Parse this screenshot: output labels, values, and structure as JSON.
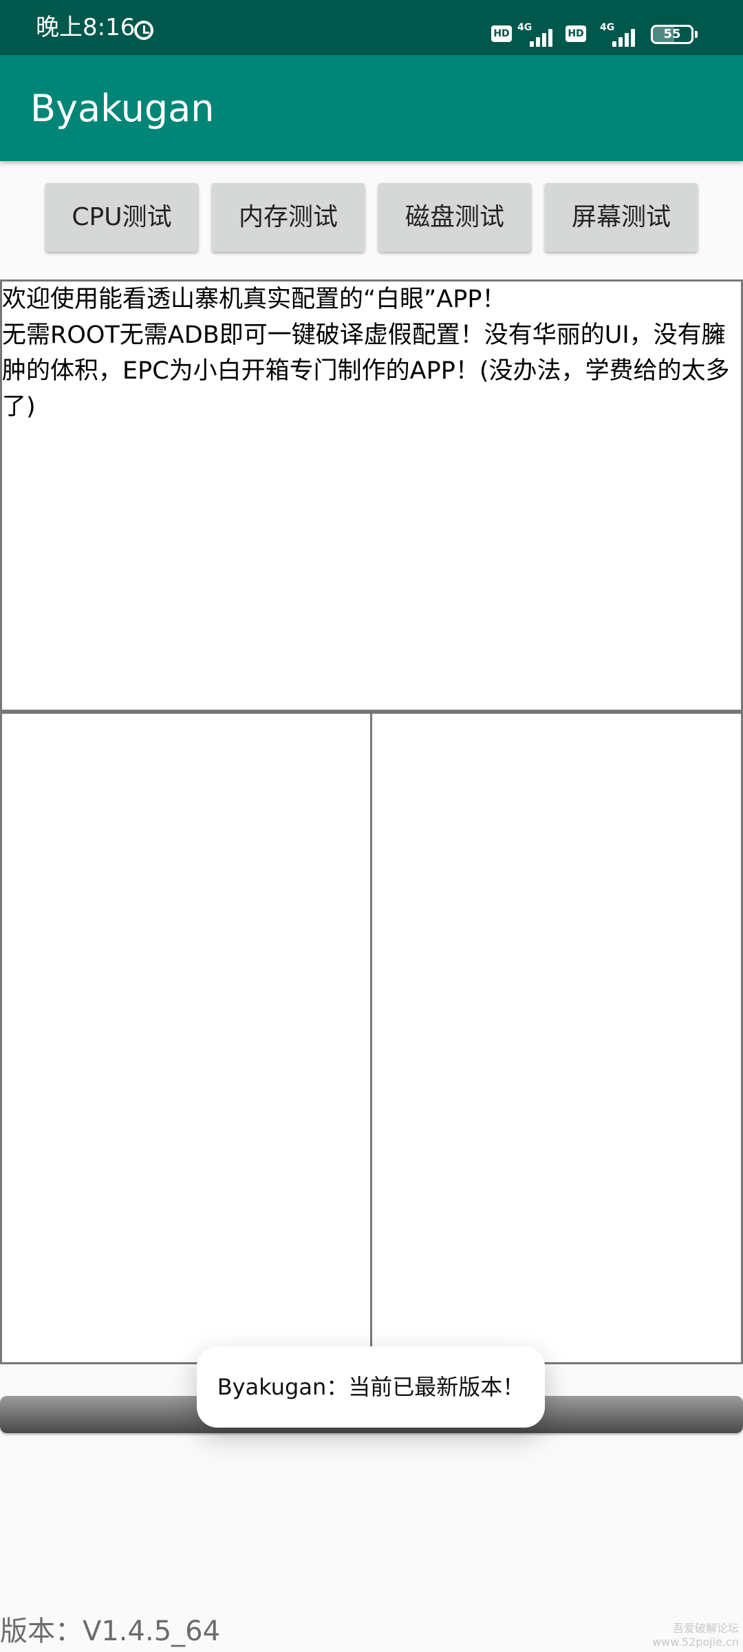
{
  "status_bar": {
    "time": "晚上8:16",
    "hd_label": "HD",
    "network_label": "4G",
    "battery_level": "55",
    "background_color": "#00574b"
  },
  "app_bar": {
    "title": "Byakugan",
    "background_color": "#008577"
  },
  "buttons": {
    "cpu": "CPU测试",
    "memory": "内存测试",
    "disk": "磁盘测试",
    "screen": "屏幕测试"
  },
  "main_text": {
    "content": "欢迎使用能看透山寨机真实配置的“白眼”APP！\n无需ROOT无需ADB即可一键破译虚假配置！没有华丽的UI，没有臃肿的体积，EPC为小白开箱专门制作的APP！(没办法，学费给的太多了)"
  },
  "panels": {
    "left": "",
    "right": ""
  },
  "toast": {
    "message": "Byakugan：当前已最新版本！"
  },
  "footer": {
    "version": "版本：V1.4.5_64",
    "watermark": "吾爱破解论坛\nwww.52pojie.cn"
  },
  "icons": {
    "alarm": "alarm-clock-icon",
    "hd": "hd-voice-icon",
    "signal": "cellular-signal-icon",
    "battery": "battery-icon"
  }
}
